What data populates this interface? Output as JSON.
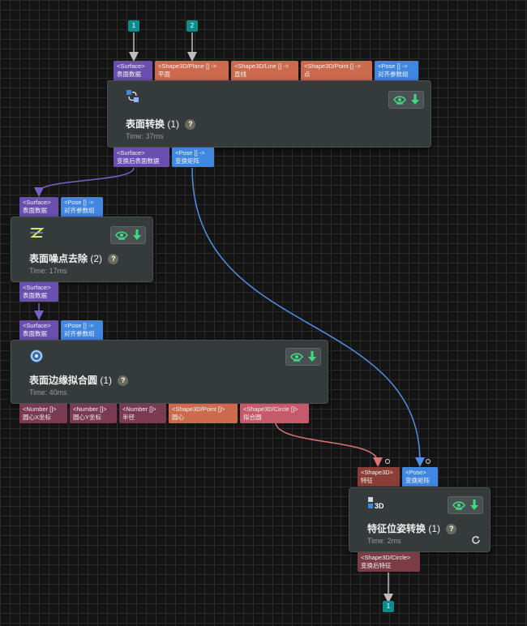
{
  "inputs": [
    {
      "label": "1"
    },
    {
      "label": "2"
    }
  ],
  "output": {
    "label": "1"
  },
  "colors": {
    "surface": "#6a4fb0",
    "pose": "#3f87e0",
    "shape": "#cc6a4d",
    "number": "#7a3a52",
    "circle": "#c45a6a",
    "wire_gray": "#bdbdbd",
    "wire_surface": "#7a5fc8",
    "wire_pose": "#4f8fe8",
    "wire_circle": "#d97474",
    "toggle_icon": "#3ddc84"
  },
  "nodes": {
    "surface_transform": {
      "title": "表面转换",
      "count": "(1)",
      "help": "?",
      "time": "Time: 37ms",
      "inputs": [
        {
          "type": "<Surface>",
          "name": "表面数据"
        },
        {
          "type": "<Shape3D/Plane [] ->",
          "name": "平面"
        },
        {
          "type": "<Shape3D/Line [] ->",
          "name": "直线"
        },
        {
          "type": "<Shape3D/Point [] ->",
          "name": "点"
        },
        {
          "type": "<Pose [] ->",
          "name": "对齐参数组"
        }
      ],
      "outputs": [
        {
          "type": "<Surface>",
          "name": "变换后表面数据"
        },
        {
          "type": "<Pose [] ->",
          "name": "变换矩阵"
        }
      ]
    },
    "noise_removal": {
      "title": "表面噪点去除",
      "count": "(2)",
      "help": "?",
      "time": "Time: 17ms",
      "inputs": [
        {
          "type": "<Surface>",
          "name": "表面数据"
        },
        {
          "type": "<Pose [] ->",
          "name": "对齐参数组"
        }
      ],
      "outputs": [
        {
          "type": "<Surface>",
          "name": "表面数据"
        }
      ]
    },
    "edge_circle_fit": {
      "title": "表面边缘拟合圆",
      "count": "(1)",
      "help": "?",
      "time": "Time: 40ms",
      "inputs": [
        {
          "type": "<Surface>",
          "name": "表面数据"
        },
        {
          "type": "<Pose [] ->",
          "name": "对齐参数组"
        }
      ],
      "outputs": [
        {
          "type": "<Number []>",
          "name": "圆心X坐标"
        },
        {
          "type": "<Number []>",
          "name": "圆心Y坐标"
        },
        {
          "type": "<Number []>",
          "name": "半径"
        },
        {
          "type": "<Shape3D/Point []>",
          "name": "圆心"
        },
        {
          "type": "<Shape3D/Circle []>",
          "name": "拟合圆"
        }
      ]
    },
    "feature_pose_transform": {
      "title": "特征位姿转换",
      "count": "(1)",
      "help": "?",
      "time": "Time: 2ms",
      "inputs": [
        {
          "type": "<Shape3D>",
          "name": "特征"
        },
        {
          "type": "<Pose>",
          "name": "变换矩阵"
        }
      ],
      "outputs": [
        {
          "type": "<Shape3D/Circle>",
          "name": "变换后特征"
        }
      ]
    }
  }
}
